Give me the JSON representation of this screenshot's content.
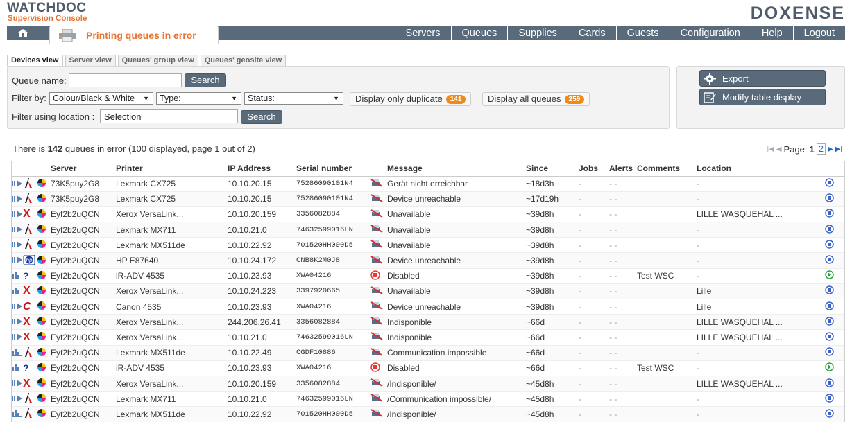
{
  "brand": {
    "app_name": "WATCHDOC",
    "app_sub": "Supervision Console",
    "company": "DOXENSE"
  },
  "nav": {
    "page_title": "Printing queues in error",
    "items": [
      "Servers",
      "Queues",
      "Supplies",
      "Cards",
      "Guests",
      "Configuration",
      "Help",
      "Logout"
    ]
  },
  "view_tabs": [
    "Devices view",
    "Server view",
    "Queues' group view",
    "Queues' geosite view"
  ],
  "filters": {
    "queue_name_label": "Queue name:",
    "queue_name_value": "",
    "search_label": "Search",
    "filter_by_label": "Filter by:",
    "colour_select": "Colour/Black & White",
    "type_select": "Type:",
    "status_select": "Status:",
    "duplicate_label": "Display only duplicate",
    "duplicate_count": "141",
    "all_label": "Display all queues",
    "all_count": "259",
    "location_label": "Filter using location :",
    "location_value": "Selection",
    "search2_label": "Search"
  },
  "actions": {
    "export": "Export",
    "modify": "Modify table display"
  },
  "summary": {
    "pre": "There is ",
    "count": "142",
    "post": " queues in error (100 displayed, page 1 out of 2)"
  },
  "pager": {
    "label": "Page:",
    "current": "1",
    "next": "2"
  },
  "table": {
    "headers": [
      "",
      "",
      "",
      "Server",
      "Printer",
      "IP Address",
      "Serial number",
      "",
      "Message",
      "Since",
      "Jobs",
      "Alerts",
      "Comments",
      "Location",
      ""
    ],
    "rows": [
      {
        "brand": "lexmark",
        "server": "73K5puy2G8",
        "printer": "Lexmark CX725",
        "ip": "10.10.20.15",
        "serial": "75286090101N4",
        "msgicon": "printer-x",
        "message": "Gerät nicht erreichbar",
        "since": "~18d3h",
        "jobs": "-",
        "alerts": "- -",
        "comments": "",
        "location": "-",
        "status": "blue"
      },
      {
        "brand": "lexmark",
        "server": "73K5puy2G8",
        "printer": "Lexmark CX725",
        "ip": "10.10.20.15",
        "serial": "75286090101N4",
        "msgicon": "printer-x",
        "message": "Device unreachable",
        "since": "~17d19h",
        "jobs": "-",
        "alerts": "- -",
        "comments": "",
        "location": "-",
        "status": "blue"
      },
      {
        "brand": "xerox",
        "server": "Eyf2b2uQCN",
        "printer": "Xerox VersaLink...",
        "ip": "10.10.20.159",
        "serial": "3356082884",
        "msgicon": "printer-x",
        "message": "Unavailable",
        "since": "~39d8h",
        "jobs": "-",
        "alerts": "- -",
        "comments": "",
        "location": "LILLE WASQUEHAL ...",
        "status": "blue"
      },
      {
        "brand": "lexmark",
        "server": "Eyf2b2uQCN",
        "printer": "Lexmark MX711",
        "ip": "10.10.21.0",
        "serial": "74632599016LN",
        "msgicon": "printer-x",
        "message": "Unavailable",
        "since": "~39d8h",
        "jobs": "-",
        "alerts": "- -",
        "comments": "",
        "location": "-",
        "status": "blue"
      },
      {
        "brand": "lexmark",
        "server": "Eyf2b2uQCN",
        "printer": "Lexmark MX511de",
        "ip": "10.10.22.92",
        "serial": "701520HH000D5",
        "msgicon": "printer-x",
        "message": "Unavailable",
        "since": "~39d8h",
        "jobs": "-",
        "alerts": "- -",
        "comments": "",
        "location": "-",
        "status": "blue"
      },
      {
        "brand": "hp",
        "server": "Eyf2b2uQCN",
        "printer": "HP E87640",
        "ip": "10.10.24.172",
        "serial": "CNB8K2M0J8",
        "msgicon": "printer-x",
        "message": "Device unreachable",
        "since": "~39d8h",
        "jobs": "-",
        "alerts": "- -",
        "comments": "",
        "location": "-",
        "status": "blue"
      },
      {
        "brand": "unknown",
        "server": "Eyf2b2uQCN",
        "printer": "iR-ADV 4535",
        "ip": "10.10.23.93",
        "serial": "XWA04216",
        "msgicon": "disabled",
        "message": "Disabled",
        "since": "~39d8h",
        "jobs": "-",
        "alerts": "- -",
        "comments": "Test WSC",
        "location": "-",
        "status": "green"
      },
      {
        "brand": "xerox",
        "server": "Eyf2b2uQCN",
        "printer": "Xerox VersaLink...",
        "ip": "10.10.24.223",
        "serial": "3397920665",
        "msgicon": "printer-x",
        "message": "Unavailable",
        "since": "~39d8h",
        "jobs": "-",
        "alerts": "- -",
        "comments": "",
        "location": "Lille",
        "status": "blue"
      },
      {
        "brand": "canon",
        "server": "Eyf2b2uQCN",
        "printer": "Canon 4535",
        "ip": "10.10.23.93",
        "serial": "XWA04216",
        "msgicon": "printer-x",
        "message": "Device unreachable",
        "since": "~39d8h",
        "jobs": "-",
        "alerts": "- -",
        "comments": "",
        "location": "Lille",
        "status": "blue"
      },
      {
        "brand": "xerox",
        "server": "Eyf2b2uQCN",
        "printer": "Xerox VersaLink...",
        "ip": "244.206.26.41",
        "serial": "3356082884",
        "msgicon": "printer-x",
        "message": "Indisponible",
        "since": "~66d",
        "jobs": "-",
        "alerts": "- -",
        "comments": "",
        "location": "LILLE WASQUEHAL ...",
        "status": "blue"
      },
      {
        "brand": "xerox",
        "server": "Eyf2b2uQCN",
        "printer": "Xerox VersaLink...",
        "ip": "10.10.21.0",
        "serial": "74632599016LN",
        "msgicon": "printer-x",
        "message": "Indisponible",
        "since": "~66d",
        "jobs": "-",
        "alerts": "- -",
        "comments": "",
        "location": "LILLE WASQUEHAL ...",
        "status": "blue"
      },
      {
        "brand": "lexmark",
        "server": "Eyf2b2uQCN",
        "printer": "Lexmark MX511de",
        "ip": "10.10.22.49",
        "serial": "CGDF10886",
        "msgicon": "printer-x",
        "message": "Communication impossible",
        "since": "~66d",
        "jobs": "-",
        "alerts": "- -",
        "comments": "",
        "location": "-",
        "status": "blue"
      },
      {
        "brand": "unknown",
        "server": "Eyf2b2uQCN",
        "printer": "iR-ADV 4535",
        "ip": "10.10.23.93",
        "serial": "XWA04216",
        "msgicon": "disabled",
        "message": "Disabled",
        "since": "~66d",
        "jobs": "-",
        "alerts": "- -",
        "comments": "Test WSC",
        "location": "-",
        "status": "green"
      },
      {
        "brand": "xerox",
        "server": "Eyf2b2uQCN",
        "printer": "Xerox VersaLink...",
        "ip": "10.10.20.159",
        "serial": "3356082884",
        "msgicon": "printer-x",
        "message": "/Indisponible/",
        "since": "~45d8h",
        "jobs": "-",
        "alerts": "- -",
        "comments": "",
        "location": "LILLE WASQUEHAL ...",
        "status": "blue"
      },
      {
        "brand": "lexmark",
        "server": "Eyf2b2uQCN",
        "printer": "Lexmark MX711",
        "ip": "10.10.21.0",
        "serial": "74632599016LN",
        "msgicon": "printer-x",
        "message": "/Communication impossible/",
        "since": "~45d8h",
        "jobs": "-",
        "alerts": "- -",
        "comments": "",
        "location": "-",
        "status": "blue"
      },
      {
        "brand": "lexmark",
        "server": "Eyf2b2uQCN",
        "printer": "Lexmark MX511de",
        "ip": "10.10.22.92",
        "serial": "701520HH000D5",
        "msgicon": "printer-x",
        "message": "/Indisponible/",
        "since": "~45d8h",
        "jobs": "-",
        "alerts": "- -",
        "comments": "",
        "location": "-",
        "status": "blue"
      }
    ],
    "row_types": [
      "queue",
      "queue",
      "queue",
      "queue",
      "queue",
      "queue",
      "stats",
      "stats",
      "queue",
      "queue",
      "queue",
      "stats",
      "stats",
      "queue",
      "queue",
      "stats"
    ]
  },
  "colors": {
    "nav": "#596a7b",
    "accent": "#e8742f",
    "badge": "#f08a1a"
  }
}
